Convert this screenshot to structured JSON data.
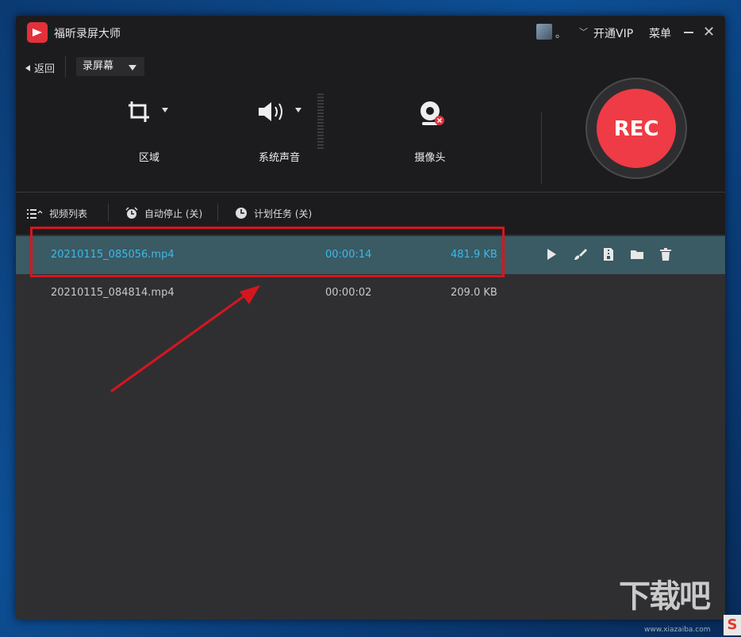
{
  "app": {
    "title": "福昕录屏大师",
    "account_dot": "。",
    "vip": "开通VIP",
    "menu": "菜单"
  },
  "toolbar": {
    "back": "返回",
    "mode": "录屏幕",
    "tools": {
      "area": "区域",
      "sound": "系统声音",
      "camera": "摄像头"
    },
    "rec": "REC"
  },
  "listbar": {
    "video_list": "视频列表",
    "auto_stop": "自动停止 (关)",
    "schedule": "计划任务 (关)"
  },
  "files": [
    {
      "name": "20210115_085056.mp4",
      "duration": "00:00:14",
      "size": "481.9 KB"
    },
    {
      "name": "20210115_084814.mp4",
      "duration": "00:00:02",
      "size": "209.0 KB"
    }
  ],
  "watermark": {
    "main": "下载吧",
    "sub": "www.xiazaiba.com",
    "logo": "S"
  },
  "colors": {
    "rec_button": "#ef3b45",
    "selected_row": "#3a5a64",
    "selected_text": "#3db9e8",
    "annotation": "#d6161e"
  }
}
